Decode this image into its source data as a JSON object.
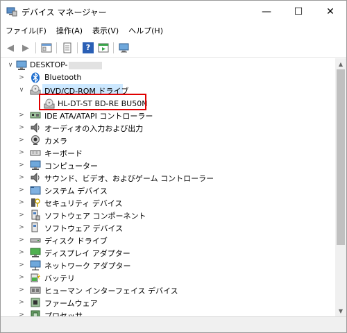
{
  "window": {
    "title": "デバイス マネージャー",
    "minimize_glyph": "—",
    "maximize_glyph": "☐",
    "close_glyph": "✕"
  },
  "menu": [
    {
      "label": "ファイル(F)"
    },
    {
      "label": "操作(A)"
    },
    {
      "label": "表示(V)"
    },
    {
      "label": "ヘルプ(H)"
    }
  ],
  "toolbar": {
    "back_glyph": "◀",
    "forward_glyph": "▶",
    "help_glyph": "?"
  },
  "tree": {
    "root": "DESKTOP-",
    "expanded_glyph": "∨",
    "collapsed_glyph": ">",
    "items": [
      {
        "label": "Bluetooth"
      },
      {
        "label": "DVD/CD-ROM ドライブ"
      },
      {
        "label": "HL-DT-ST BD-RE BU50N"
      },
      {
        "label": "IDE ATA/ATAPI コントローラー"
      },
      {
        "label": "オーディオの入力および出力"
      },
      {
        "label": "カメラ"
      },
      {
        "label": "キーボード"
      },
      {
        "label": "コンピューター"
      },
      {
        "label": "サウンド、ビデオ、およびゲーム コントローラー"
      },
      {
        "label": "システム デバイス"
      },
      {
        "label": "セキュリティ デバイス"
      },
      {
        "label": "ソフトウェア コンポーネント"
      },
      {
        "label": "ソフトウェア デバイス"
      },
      {
        "label": "ディスク ドライブ"
      },
      {
        "label": "ディスプレイ アダプター"
      },
      {
        "label": "ネットワーク アダプター"
      },
      {
        "label": "バッテリ"
      },
      {
        "label": "ヒューマン インターフェイス デバイス"
      },
      {
        "label": "ファームウェア"
      },
      {
        "label": "プロセッサ"
      }
    ]
  },
  "scrollbar": {
    "up_glyph": "▲",
    "down_glyph": "▼"
  },
  "colors": {
    "highlight_border": "#e00000",
    "selection": "#cce8ff"
  }
}
